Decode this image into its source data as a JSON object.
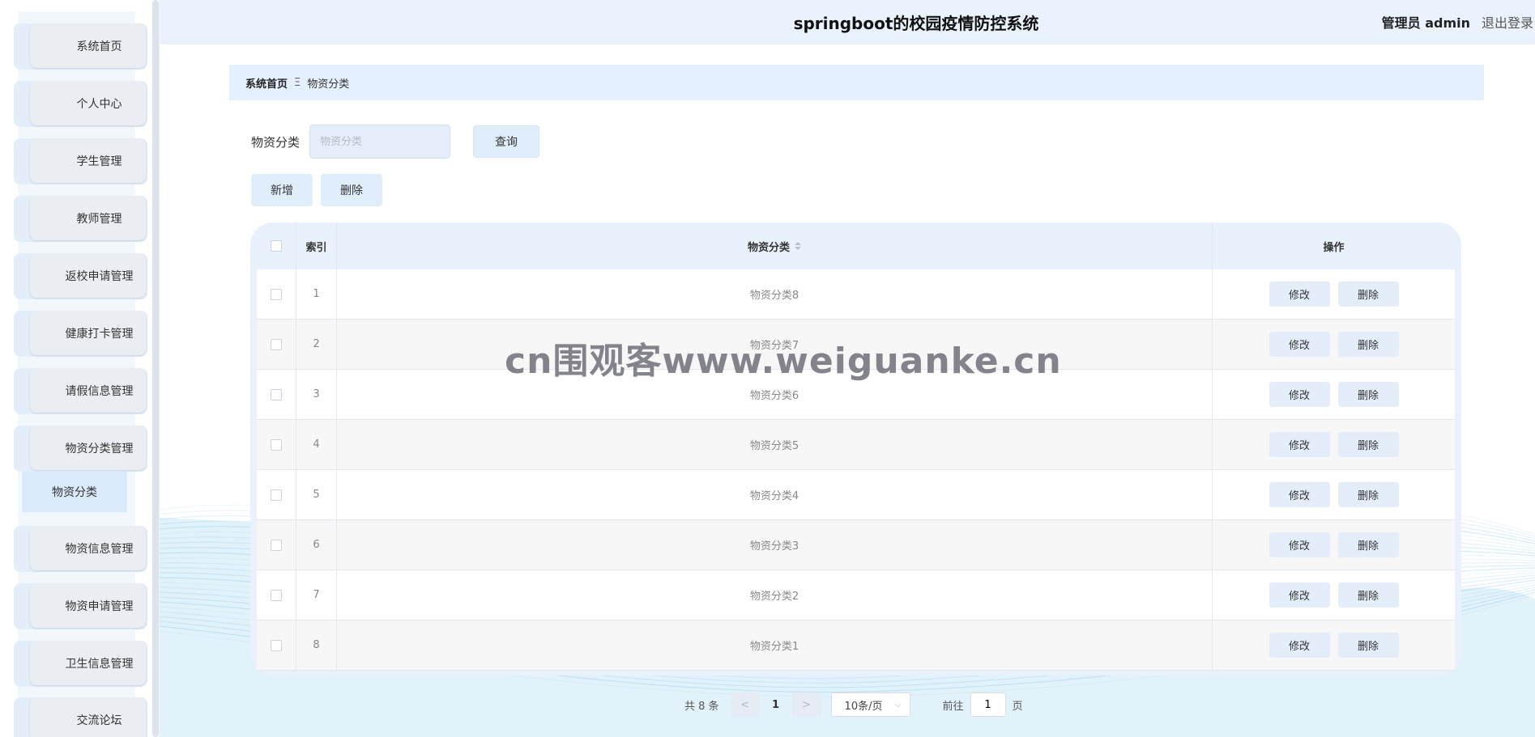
{
  "header": {
    "title": "springboot的校园疫情防控系统",
    "user": "管理员 admin",
    "logout": "退出登录"
  },
  "sidebar": {
    "items": [
      {
        "label": "系统首页"
      },
      {
        "label": "个人中心"
      },
      {
        "label": "学生管理"
      },
      {
        "label": "教师管理"
      },
      {
        "label": "返校申请管理"
      },
      {
        "label": "健康打卡管理"
      },
      {
        "label": "请假信息管理"
      },
      {
        "label": "物资分类管理"
      },
      {
        "label": "物资信息管理"
      },
      {
        "label": "物资申请管理"
      },
      {
        "label": "卫生信息管理"
      },
      {
        "label": "交流论坛"
      }
    ],
    "submenu": {
      "label": "物资分类"
    }
  },
  "breadcrumb": {
    "home": "系统首页",
    "separator": "Ξ",
    "current": "物资分类"
  },
  "search": {
    "label": "物资分类",
    "placeholder": "物资分类",
    "query_button": "查询"
  },
  "actions": {
    "add": "新增",
    "delete": "删除"
  },
  "table": {
    "headers": {
      "index": "索引",
      "name": "物资分类",
      "ops": "操作"
    },
    "rows": [
      {
        "index": "1",
        "name": "物资分类8"
      },
      {
        "index": "2",
        "name": "物资分类7"
      },
      {
        "index": "3",
        "name": "物资分类6"
      },
      {
        "index": "4",
        "name": "物资分类5"
      },
      {
        "index": "5",
        "name": "物资分类4"
      },
      {
        "index": "6",
        "name": "物资分类3"
      },
      {
        "index": "7",
        "name": "物资分类2"
      },
      {
        "index": "8",
        "name": "物资分类1"
      }
    ],
    "edit_label": "修改",
    "delete_label": "删除"
  },
  "pagination": {
    "total": "共 8 条",
    "prev": "<",
    "current": "1",
    "next": ">",
    "page_size": "10条/页",
    "goto_label": "前往",
    "goto_value": "1",
    "page_suffix": "页"
  },
  "watermark": "cn围观客www.weiguanke.cn",
  "colors": {
    "accent": "#e4eefb",
    "header_bg": "#eaf3fd",
    "wave": "#5fb6e8"
  }
}
